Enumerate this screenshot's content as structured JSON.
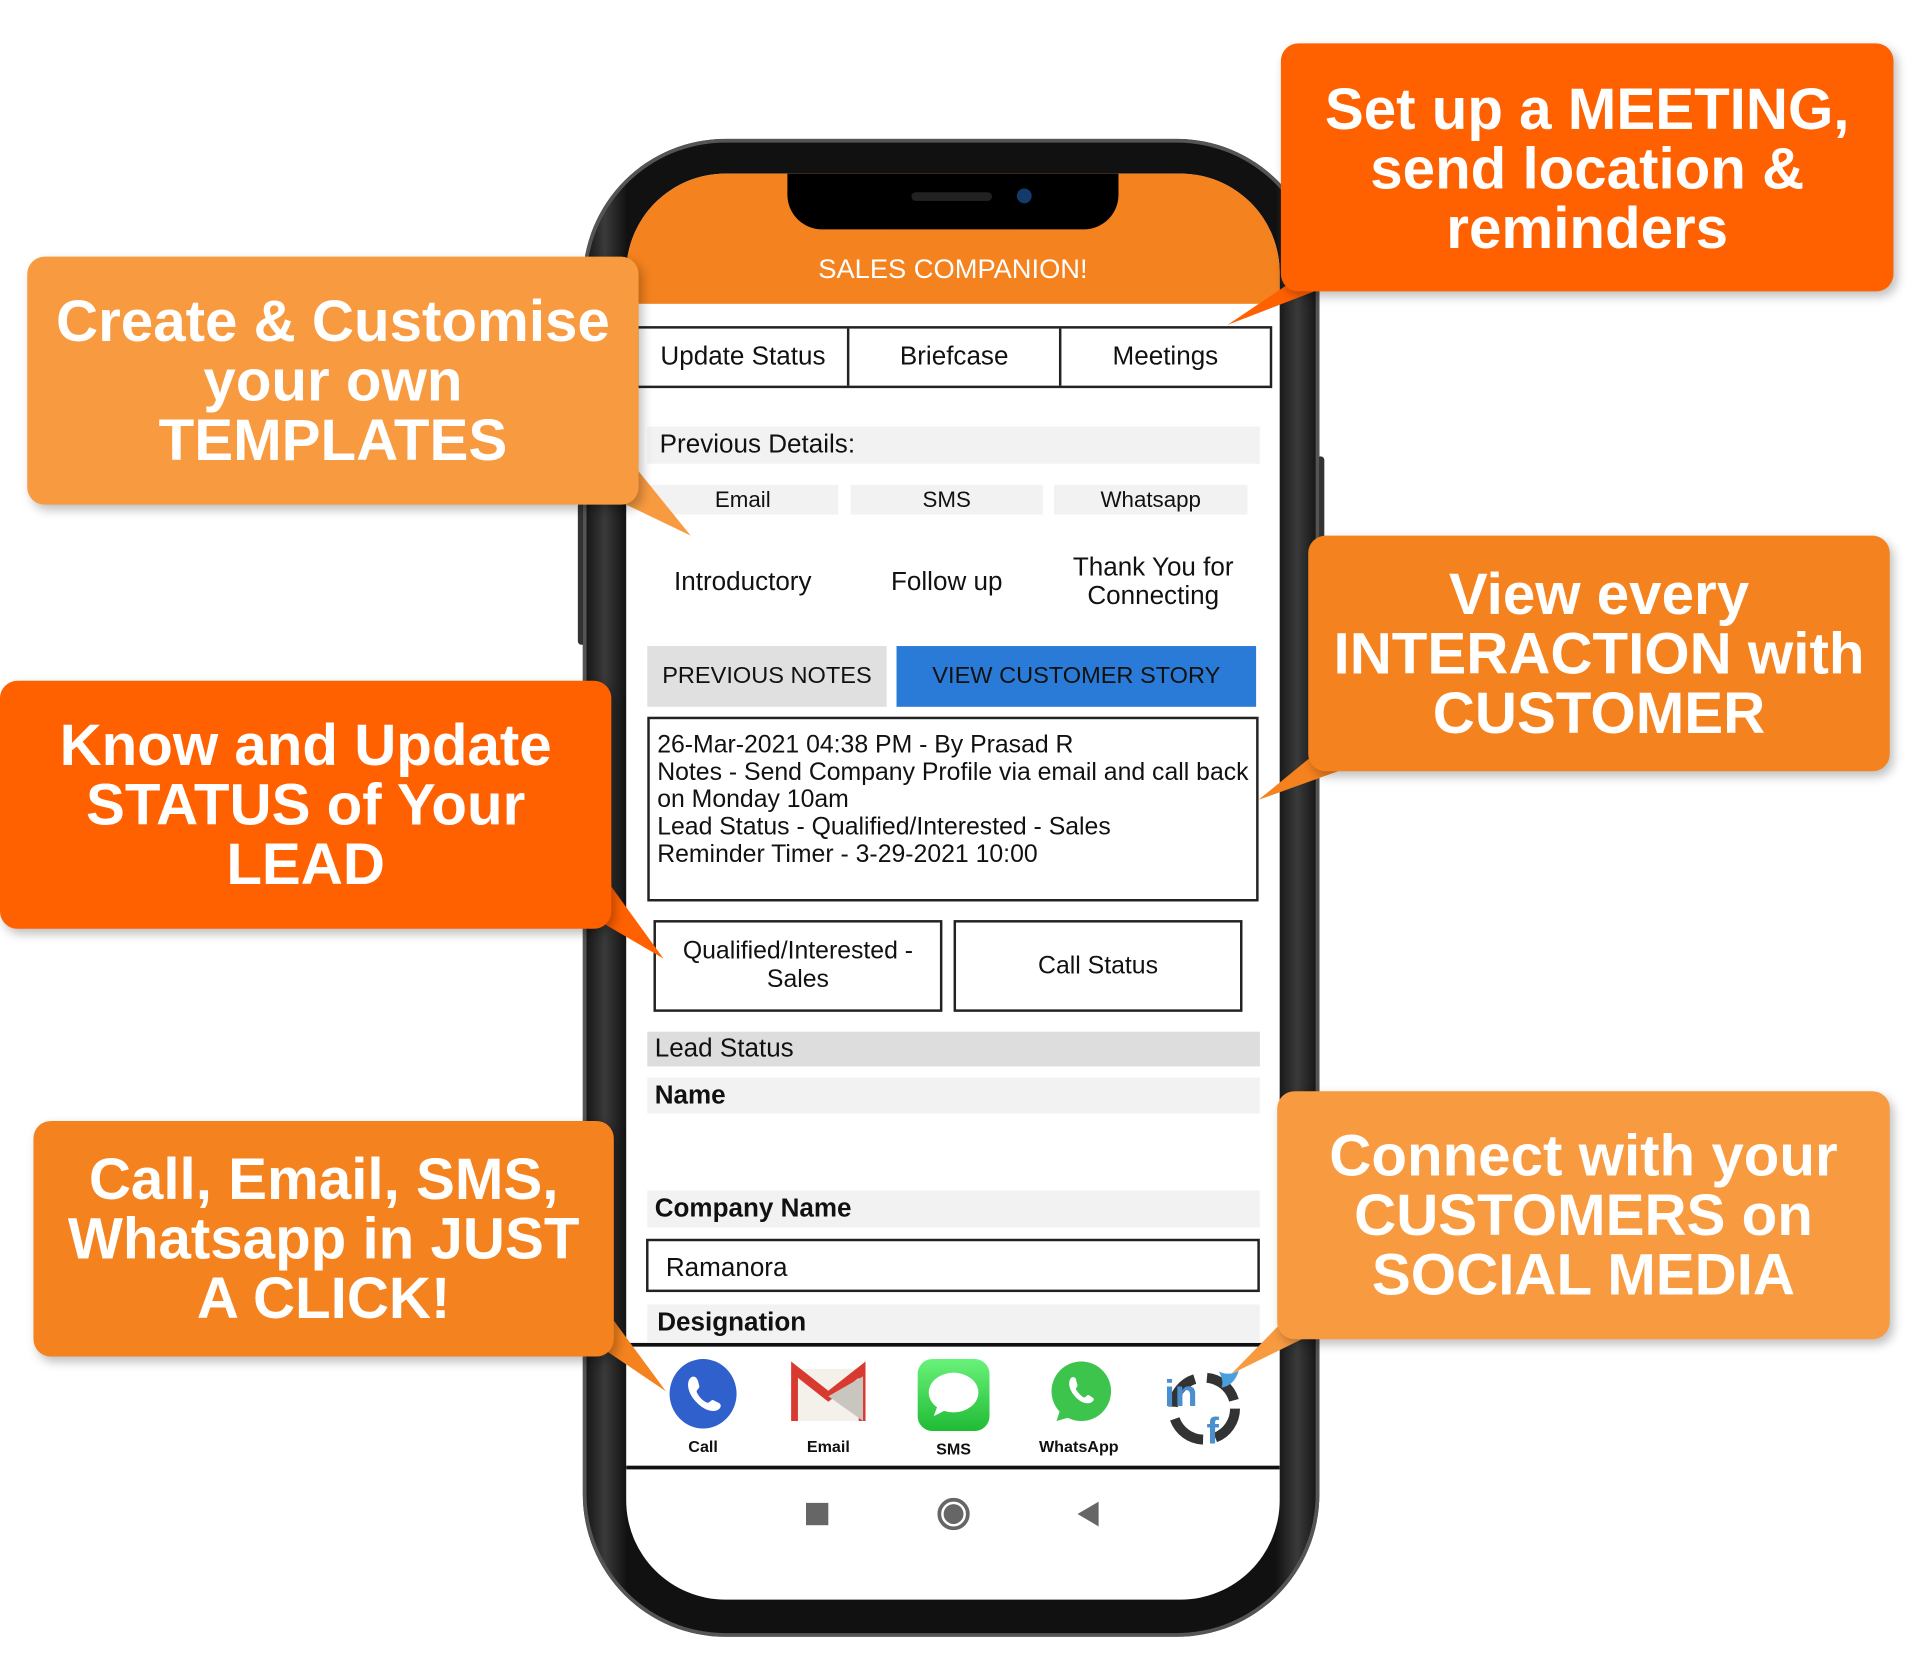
{
  "app": {
    "title": "SALES COMPANION!"
  },
  "tabs": [
    "Update Status",
    "Briefcase",
    "Meetings"
  ],
  "previous_details": {
    "label": "Previous Details:",
    "channels": [
      "Email",
      "SMS",
      "Whatsapp"
    ],
    "templates": [
      "Introductory",
      "Follow up",
      "Thank You for Connecting"
    ]
  },
  "buttons": {
    "previous_notes": "PREVIOUS NOTES",
    "view_story": "VIEW CUSTOMER STORY"
  },
  "notes": {
    "line1": "26-Mar-2021 04:38 PM - By Prasad R",
    "line2": "Notes - Send Company Profile via email and call back on Monday 10am",
    "line3": "Lead Status - Qualified/Interested - Sales",
    "line4": "Reminder Timer - 3-29-2021 10:00"
  },
  "status": {
    "lead_status_value": "Qualified/Interested - Sales",
    "call_status": "Call Status"
  },
  "form": {
    "lead_status_label": "Lead Status",
    "name_label": "Name",
    "company_label": "Company Name",
    "company_value": "Ramanora",
    "designation_label": "Designation"
  },
  "dock": [
    {
      "label": "Call",
      "icon": "phone-icon"
    },
    {
      "label": "Email",
      "icon": "gmail-icon"
    },
    {
      "label": "SMS",
      "icon": "message-icon"
    },
    {
      "label": "WhatsApp",
      "icon": "whatsapp-icon"
    },
    {
      "label": "",
      "icon": "social-media-icon"
    }
  ],
  "callouts": {
    "meeting": "Set up a MEETING, send location & reminders",
    "templates": "Create & Customise your own TEMPLATES",
    "interaction": "View every INTERACTION with CUSTOMER",
    "status": "Know and Update STATUS of Your LEAD",
    "contact": "Call, Email, SMS, Whatsapp in JUST A CLICK!",
    "social": "Connect with your CUSTOMERS on SOCIAL MEDIA"
  },
  "colors": {
    "orange_dark": "#ff6000",
    "orange": "#f4821e",
    "orange_light": "#f89a40",
    "blue": "#2a7bd8"
  }
}
